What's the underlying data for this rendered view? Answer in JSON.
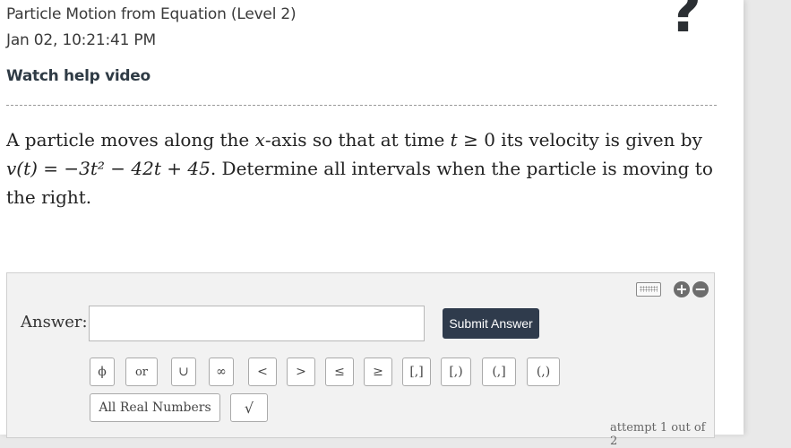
{
  "header": {
    "title": "Particle Motion from Equation (Level 2)",
    "timestamp": "Jan 02, 10:21:41 PM",
    "help_link": "Watch help video",
    "help_icon_glyph": "?"
  },
  "question": {
    "part1": "A particle moves along the ",
    "x": "x",
    "part2": "-axis so that at time ",
    "t": "t",
    "cond": " ≥ 0 its velocity is given by",
    "v_eq": "v(t) = −3t² − 42t + 45",
    "part3": ". Determine all intervals when the particle is moving to the right."
  },
  "answer": {
    "label": "Answer:",
    "input_value": "",
    "submit_label": "Submit Answer",
    "symbols": [
      "ϕ",
      "or",
      "∪",
      "∞",
      "<",
      ">",
      "≤",
      "≥",
      "[,]",
      "[,)",
      "(,]",
      "(,)"
    ],
    "all_real_label": "All Real Numbers",
    "sqrt_label": "√",
    "attempt_text": "attempt 1 out of 2"
  },
  "controls": {
    "zoom_in": "+",
    "zoom_out": "−"
  },
  "colors": {
    "submit_bg": "#2f3b4c",
    "panel_bg": "#f2f2f2"
  }
}
